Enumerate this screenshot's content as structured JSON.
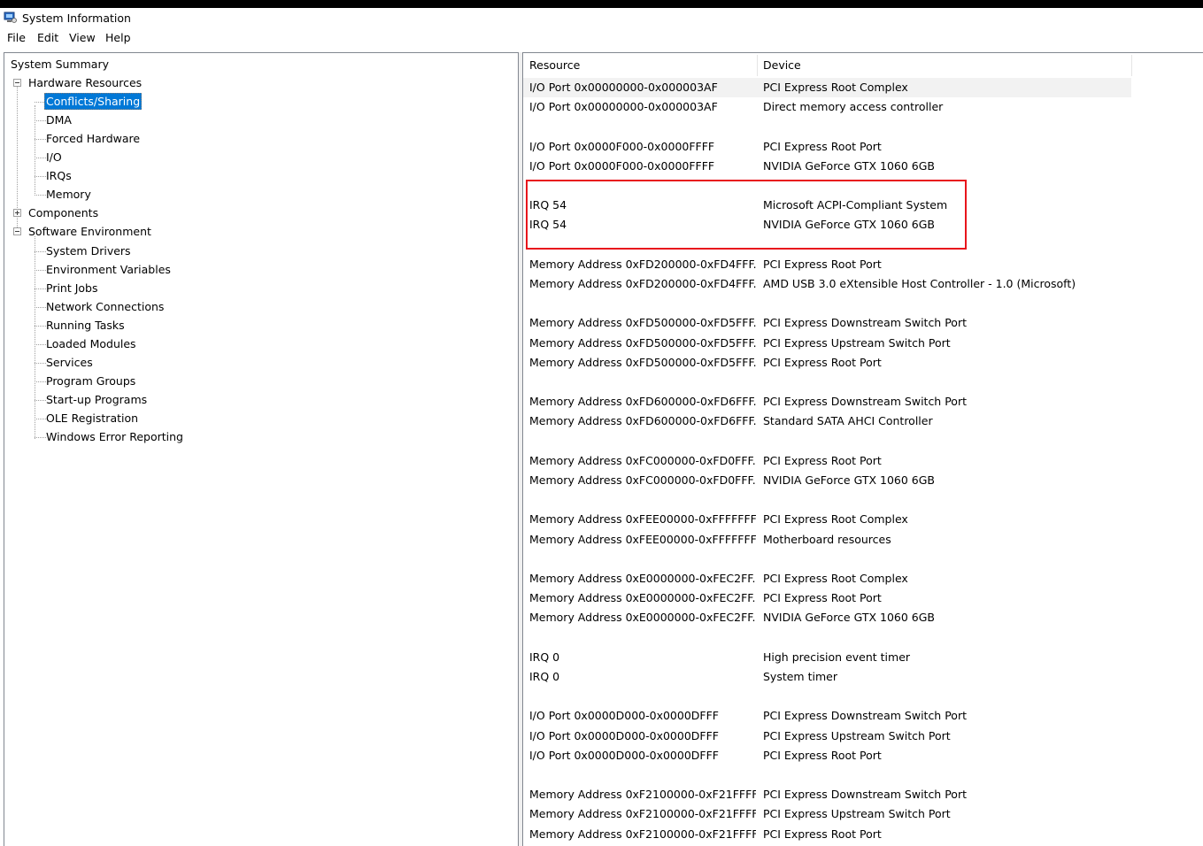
{
  "window": {
    "title": "System Information",
    "icon": "system-information-icon"
  },
  "menu": [
    "File",
    "Edit",
    "View",
    "Help"
  ],
  "tree": {
    "root": "System Summary",
    "hardware": {
      "label": "Hardware Resources",
      "children": [
        "Conflicts/Sharing",
        "DMA",
        "Forced Hardware",
        "I/O",
        "IRQs",
        "Memory"
      ],
      "selected": "Conflicts/Sharing"
    },
    "components": "Components",
    "software": {
      "label": "Software Environment",
      "children": [
        "System Drivers",
        "Environment Variables",
        "Print Jobs",
        "Network Connections",
        "Running Tasks",
        "Loaded Modules",
        "Services",
        "Program Groups",
        "Start-up Programs",
        "OLE Registration",
        "Windows Error Reporting"
      ]
    }
  },
  "list": {
    "headers": {
      "resource": "Resource",
      "device": "Device"
    },
    "rows": [
      {
        "resource": "I/O Port 0x00000000-0x000003AF",
        "device": "PCI Express Root Complex"
      },
      {
        "resource": "I/O Port 0x00000000-0x000003AF",
        "device": "Direct memory access controller"
      },
      {
        "resource": "",
        "device": ""
      },
      {
        "resource": "I/O Port 0x0000F000-0x0000FFFF",
        "device": "PCI Express Root Port"
      },
      {
        "resource": "I/O Port 0x0000F000-0x0000FFFF",
        "device": "NVIDIA GeForce GTX 1060 6GB"
      },
      {
        "resource": "",
        "device": ""
      },
      {
        "resource": "IRQ 54",
        "device": "Microsoft ACPI-Compliant System"
      },
      {
        "resource": "IRQ 54",
        "device": "NVIDIA GeForce GTX 1060 6GB"
      },
      {
        "resource": "",
        "device": ""
      },
      {
        "resource": "Memory Address 0xFD200000-0xFD4FFF...",
        "device": "PCI Express Root Port"
      },
      {
        "resource": "Memory Address 0xFD200000-0xFD4FFF...",
        "device": "AMD USB 3.0 eXtensible Host Controller - 1.0 (Microsoft)"
      },
      {
        "resource": "",
        "device": ""
      },
      {
        "resource": "Memory Address 0xFD500000-0xFD5FFF...",
        "device": "PCI Express Downstream Switch Port"
      },
      {
        "resource": "Memory Address 0xFD500000-0xFD5FFF...",
        "device": "PCI Express Upstream Switch Port"
      },
      {
        "resource": "Memory Address 0xFD500000-0xFD5FFF...",
        "device": "PCI Express Root Port"
      },
      {
        "resource": "",
        "device": ""
      },
      {
        "resource": "Memory Address 0xFD600000-0xFD6FFF...",
        "device": "PCI Express Downstream Switch Port"
      },
      {
        "resource": "Memory Address 0xFD600000-0xFD6FFF...",
        "device": "Standard SATA AHCI Controller"
      },
      {
        "resource": "",
        "device": ""
      },
      {
        "resource": "Memory Address 0xFC000000-0xFD0FFF...",
        "device": "PCI Express Root Port"
      },
      {
        "resource": "Memory Address 0xFC000000-0xFD0FFF...",
        "device": "NVIDIA GeForce GTX 1060 6GB"
      },
      {
        "resource": "",
        "device": ""
      },
      {
        "resource": "Memory Address 0xFEE00000-0xFFFFFFFF",
        "device": "PCI Express Root Complex"
      },
      {
        "resource": "Memory Address 0xFEE00000-0xFFFFFFFF",
        "device": "Motherboard resources"
      },
      {
        "resource": "",
        "device": ""
      },
      {
        "resource": "Memory Address 0xE0000000-0xFEC2FF...",
        "device": "PCI Express Root Complex"
      },
      {
        "resource": "Memory Address 0xE0000000-0xFEC2FF...",
        "device": "PCI Express Root Port"
      },
      {
        "resource": "Memory Address 0xE0000000-0xFEC2FF...",
        "device": "NVIDIA GeForce GTX 1060 6GB"
      },
      {
        "resource": "",
        "device": ""
      },
      {
        "resource": "IRQ 0",
        "device": "High precision event timer"
      },
      {
        "resource": "IRQ 0",
        "device": "System timer"
      },
      {
        "resource": "",
        "device": ""
      },
      {
        "resource": "I/O Port 0x0000D000-0x0000DFFF",
        "device": "PCI Express Downstream Switch Port"
      },
      {
        "resource": "I/O Port 0x0000D000-0x0000DFFF",
        "device": "PCI Express Upstream Switch Port"
      },
      {
        "resource": "I/O Port 0x0000D000-0x0000DFFF",
        "device": "PCI Express Root Port"
      },
      {
        "resource": "",
        "device": ""
      },
      {
        "resource": "Memory Address 0xF2100000-0xF21FFFFF",
        "device": "PCI Express Downstream Switch Port"
      },
      {
        "resource": "Memory Address 0xF2100000-0xF21FFFFF",
        "device": "PCI Express Upstream Switch Port"
      },
      {
        "resource": "Memory Address 0xF2100000-0xF21FFFFF",
        "device": "PCI Express Root Port"
      }
    ]
  },
  "annotation": {
    "color": "#e8141c"
  },
  "colors": {
    "selection": "#0078d7",
    "header_separator": "#e5e5e5",
    "first_row": "#f2f2f2"
  }
}
